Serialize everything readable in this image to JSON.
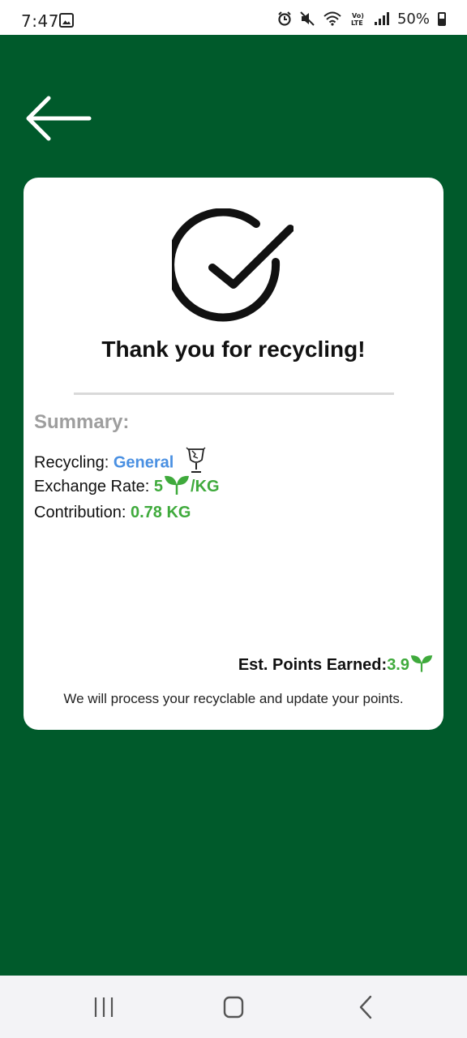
{
  "status_bar": {
    "time": "7:47",
    "battery": "50%",
    "icons": [
      "gallery-icon",
      "alarm-icon",
      "mute-icon",
      "wifi-icon",
      "volte-icon",
      "signal-icon",
      "battery-icon"
    ]
  },
  "colors": {
    "background": "#005a2b",
    "card": "#ffffff",
    "accent_green": "#3faa3c",
    "accent_blue": "#4a90e2"
  },
  "card": {
    "title": "Thank you for recycling!",
    "summary_label": "Summary:",
    "recycling_label": "Recycling:",
    "recycling_value": "General",
    "exchange_label": "Exchange Rate:",
    "exchange_value": "5",
    "exchange_unit": "/KG",
    "contribution_label": "Contribution:",
    "contribution_value": "0.78 KG",
    "est_label": "Est. Points Earned:",
    "est_value": "3.9",
    "note": "We will process your recyclable and update your points."
  },
  "nav": {
    "icons": [
      "recent-apps-icon",
      "home-icon",
      "back-icon"
    ]
  }
}
